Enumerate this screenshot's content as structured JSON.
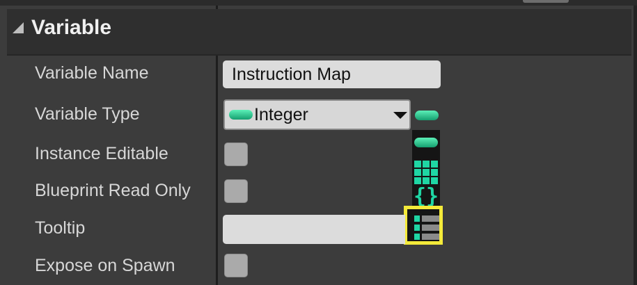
{
  "section": {
    "title": "Variable"
  },
  "rows": {
    "variable_name": {
      "label": "Variable Name",
      "value": "Instruction Map"
    },
    "variable_type": {
      "label": "Variable Type",
      "value": "Integer"
    },
    "instance_editable": {
      "label": "Instance Editable",
      "checked": false
    },
    "blueprint_read_only": {
      "label": "Blueprint Read Only",
      "checked": false
    },
    "tooltip": {
      "label": "Tooltip",
      "value": ""
    },
    "expose_on_spawn": {
      "label": "Expose on Spawn",
      "checked": false
    }
  },
  "container_type_options": [
    "single",
    "array",
    "set",
    "map"
  ],
  "container_type_icons": [
    "single-variable-icon",
    "array-icon",
    "set-icon",
    "map-icon"
  ],
  "highlighted_option": "map",
  "colors": {
    "integer_pin": "#1fd6a4",
    "highlight": "#f4ea3a",
    "panel_bg": "#3c3c3c"
  }
}
